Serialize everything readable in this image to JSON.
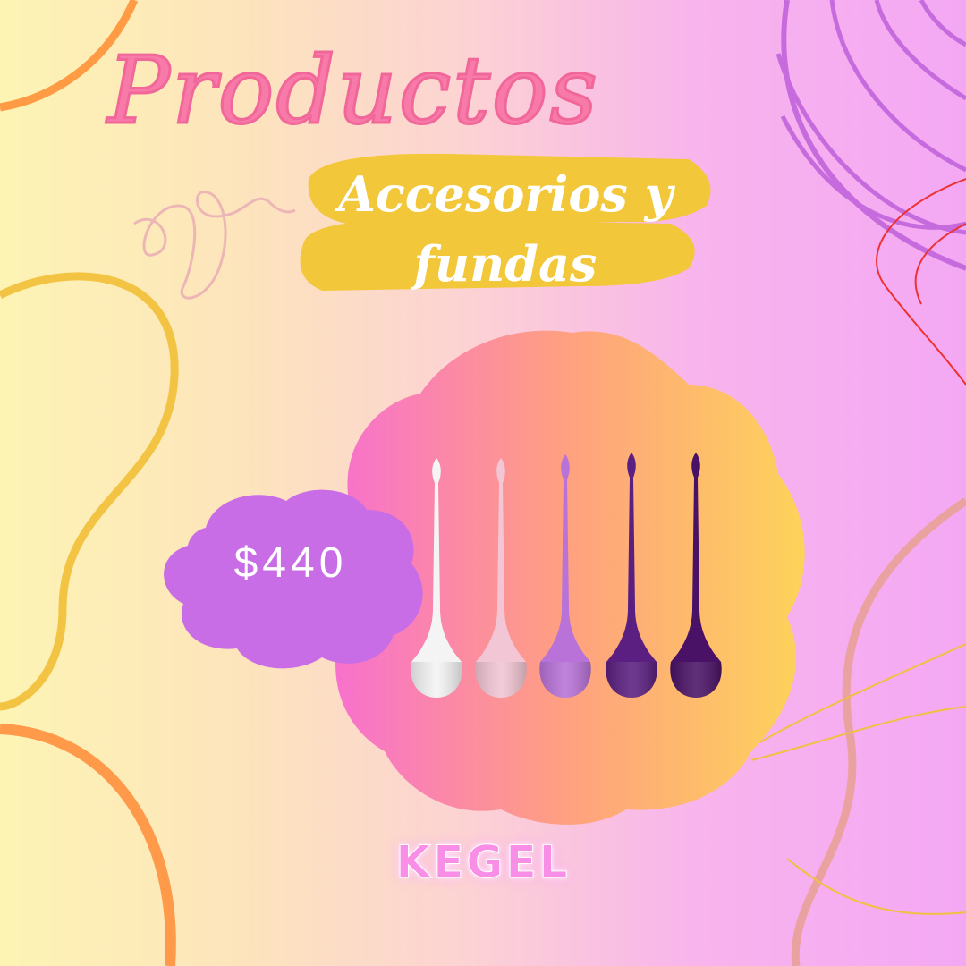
{
  "header": {
    "title": "Productos"
  },
  "subtitle": {
    "line1": "Accesorios y",
    "line2": "fundas"
  },
  "product": {
    "price": "$440",
    "name": "KEGEL",
    "image": "kegel-balls-set-of-five",
    "ball_colors": [
      "#f4f4f4",
      "#f2c6d4",
      "#b872d8",
      "#5a1f80",
      "#4a1266"
    ]
  },
  "colors": {
    "title": "#f77aa8",
    "subtitle_highlight": "#f2c73a",
    "price_cloud": "#c96de6",
    "blob_gradient": [
      "#f76fd0",
      "#ffa080",
      "#fdd35a"
    ]
  }
}
